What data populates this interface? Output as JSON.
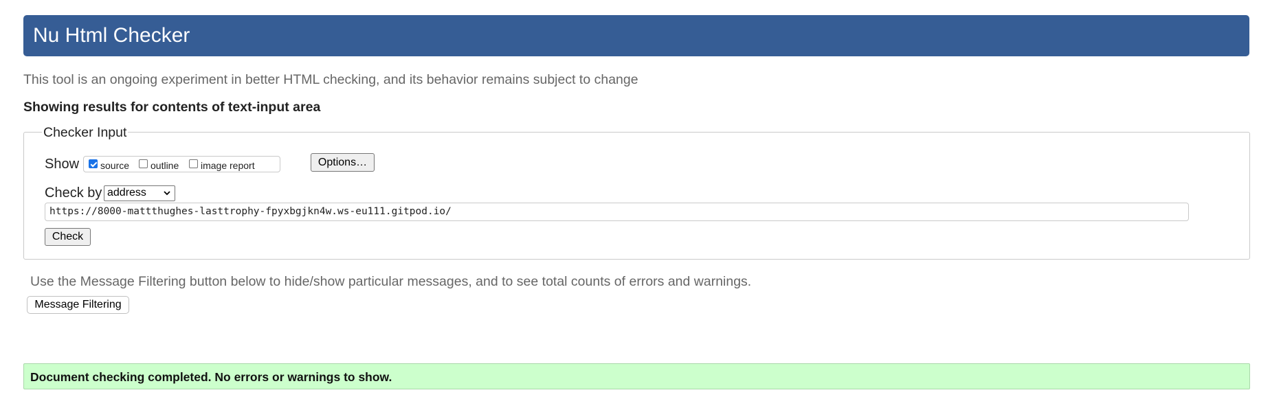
{
  "header": {
    "title": "Nu Html Checker"
  },
  "tagline": "This tool is an ongoing experiment in better HTML checking, and its behavior remains subject to change",
  "showing": "Showing results for contents of text-input area",
  "checker_input": {
    "legend": "Checker Input",
    "show_label": "Show",
    "show_options": [
      {
        "label": "source",
        "checked": true
      },
      {
        "label": "outline",
        "checked": false
      },
      {
        "label": "image report",
        "checked": false
      }
    ],
    "options_button": "Options…",
    "check_by_label": "Check by",
    "check_by_value": "address",
    "url_value": "https://8000-mattthughes-lasttrophy-fpyxbgjkn4w.ws-eu111.gitpod.io/",
    "check_button": "Check"
  },
  "filter_note": "Use the Message Filtering button below to hide/show particular messages, and to see total counts of errors and warnings.",
  "filter_button": "Message Filtering",
  "result": "Document checking completed. No errors or warnings to show.",
  "colors": {
    "header_bg": "#365d95",
    "success_bg": "#ccffcc",
    "muted_text": "#666666"
  }
}
